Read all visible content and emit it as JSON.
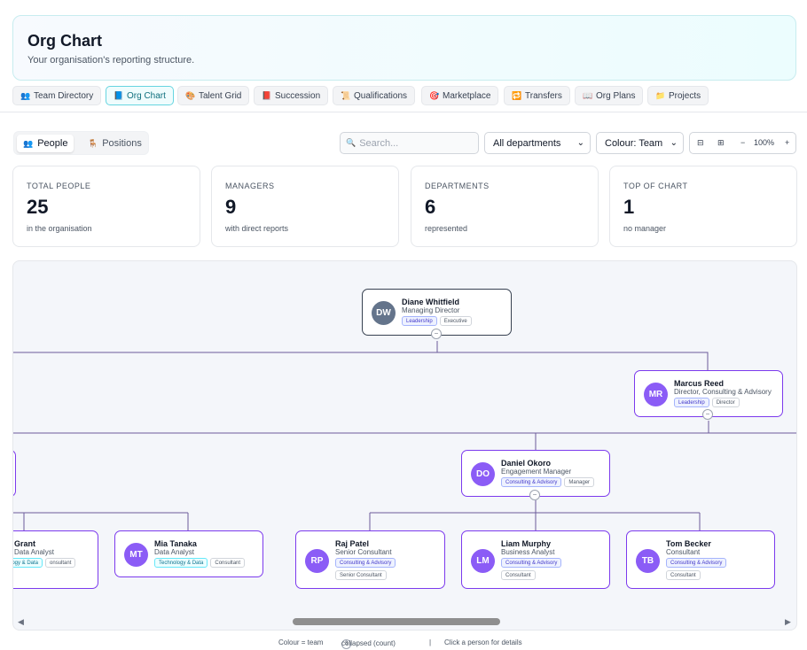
{
  "header": {
    "title": "Org Chart",
    "subtitle": "Your organisation's reporting structure."
  },
  "nav": {
    "tabs": [
      {
        "label": "Team Directory",
        "icon": "people-icon",
        "glyph": "👥"
      },
      {
        "label": "Org Chart",
        "icon": "org-chart-icon",
        "glyph": "📘"
      },
      {
        "label": "Talent Grid",
        "icon": "grid-icon",
        "glyph": "🎨"
      },
      {
        "label": "Succession",
        "icon": "succession-icon",
        "glyph": "📕"
      },
      {
        "label": "Qualifications",
        "icon": "scroll-icon",
        "glyph": "📜"
      },
      {
        "label": "Marketplace",
        "icon": "target-icon",
        "glyph": "🎯"
      },
      {
        "label": "Transfers",
        "icon": "transfer-icon",
        "glyph": "🔁"
      },
      {
        "label": "Org Plans",
        "icon": "book-icon",
        "glyph": "📖"
      },
      {
        "label": "Projects",
        "icon": "folder-icon",
        "glyph": "📁"
      }
    ],
    "active": "Org Chart"
  },
  "toolbar": {
    "view_people": "People",
    "view_positions": "Positions",
    "search_placeholder": "Search...",
    "department_select": "All departments",
    "colour_select": "Colour: Team",
    "zoom_level": "100%",
    "zoom_minus": "−",
    "zoom_plus": "+"
  },
  "stats": [
    {
      "label": "TOTAL PEOPLE",
      "value": "25",
      "sub": "in the organisation"
    },
    {
      "label": "MANAGERS",
      "value": "9",
      "sub": "with direct reports"
    },
    {
      "label": "DEPARTMENTS",
      "value": "6",
      "sub": "represented"
    },
    {
      "label": "TOP OF CHART",
      "value": "1",
      "sub": "no manager"
    }
  ],
  "people": {
    "diane": {
      "initials": "DW",
      "name": "Diane Whitfield",
      "role": "Managing Director",
      "team": "Leadership",
      "position": "Executive"
    },
    "marcus": {
      "initials": "MR",
      "name": "Marcus Reed",
      "role": "Director, Consulting & Advisory",
      "team": "Leadership",
      "position": "Director"
    },
    "daniel": {
      "initials": "DO",
      "name": "Daniel Okoro",
      "role": "Engagement Manager",
      "team": "Consulting & Advisory",
      "position": "Manager"
    },
    "grant": {
      "name": "Grant",
      "role": "Data Analyst",
      "team": "logy & Data",
      "position": "onsultant"
    },
    "mia": {
      "initials": "MT",
      "name": "Mia Tanaka",
      "role": "Data Analyst",
      "team": "Technology & Data",
      "position": "Consultant"
    },
    "raj": {
      "initials": "RP",
      "name": "Raj Patel",
      "role": "Senior Consultant",
      "team": "Consulting & Advisory",
      "position": "Senior Consultant"
    },
    "liam": {
      "initials": "LM",
      "name": "Liam Murphy",
      "role": "Business Analyst",
      "team": "Consulting & Advisory",
      "position": "Consultant"
    },
    "tom": {
      "initials": "TB",
      "name": "Tom Becker",
      "role": "Consultant",
      "team": "Consulting & Advisory",
      "position": "Consultant"
    }
  },
  "collapse_glyph": "−",
  "footer": {
    "legend_colour": "Colour = team",
    "collapsed_count": "3",
    "collapsed_label": "collapsed (count)",
    "divider": "|",
    "hint": "Click a person for details"
  },
  "colors": {
    "accent": "#7c3aed",
    "avatar": "#8b5cf6",
    "active_tab": "#67d5e0"
  }
}
